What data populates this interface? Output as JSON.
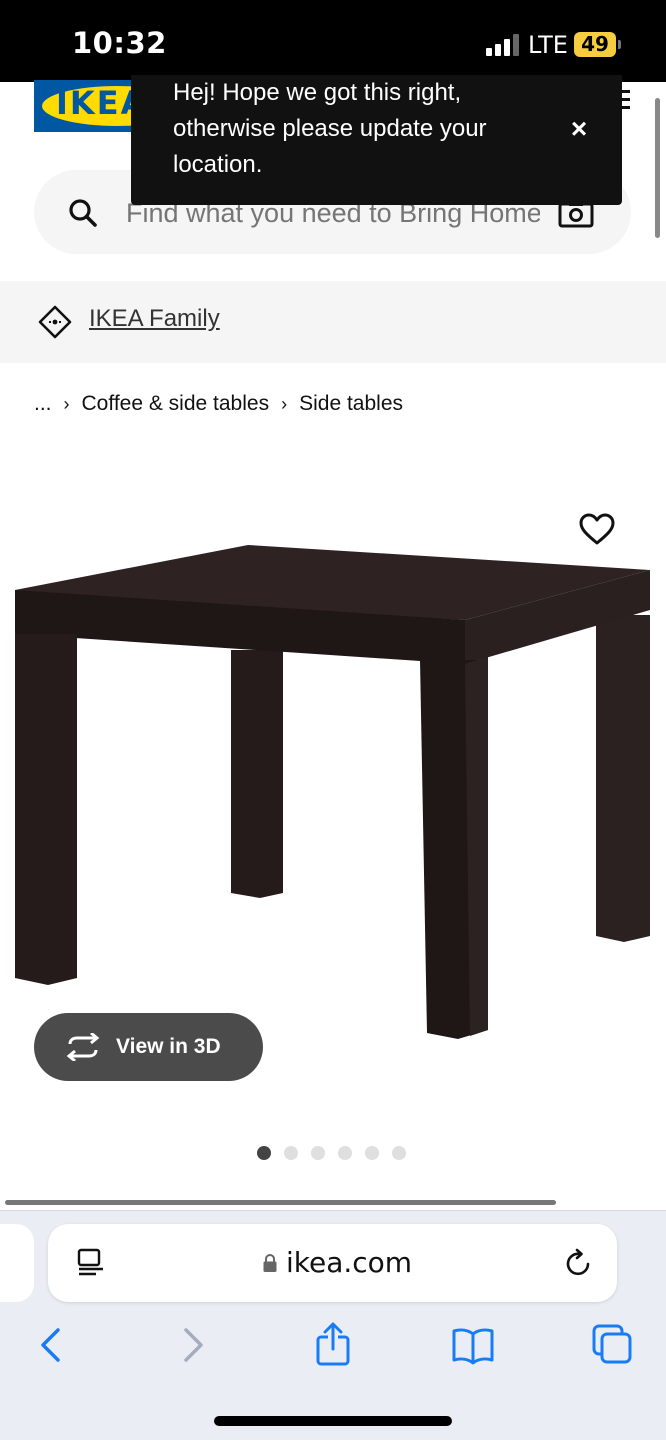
{
  "status_bar": {
    "time": "10:32",
    "network": "LTE",
    "battery": "49",
    "battery_color": "#f5cd3e"
  },
  "header": {
    "logo_text": "IKEA",
    "logo_colors": {
      "blue": "#0058a3",
      "yellow": "#ffdb00"
    },
    "menu_icon": "hamburger-menu-icon"
  },
  "location_popup": {
    "message": "Hej! Hope we got this right, otherwise please update your location.",
    "close_label": "×"
  },
  "search": {
    "placeholder": "Find what you need to Bring Home",
    "search_icon": "search-icon",
    "camera_icon": "camera-icon"
  },
  "family": {
    "label": "IKEA Family",
    "icon": "tag-icon"
  },
  "breadcrumb": {
    "ellipsis": "...",
    "items": [
      "Coffee & side tables",
      "Side tables"
    ],
    "separator": "›"
  },
  "product": {
    "favorite_icon": "heart-icon",
    "view3d_label": "View in 3D",
    "image_count": 6,
    "active_image": 1,
    "table_color": "#2b2120"
  },
  "browser": {
    "url": "ikea.com",
    "reader_icon": "reader-mode-icon",
    "lock_icon": "lock-icon",
    "reload_icon": "reload-icon",
    "toolbar": [
      "back-icon",
      "forward-icon",
      "share-icon",
      "bookmarks-icon",
      "tabs-icon"
    ],
    "accent": "#1a7cf5"
  }
}
